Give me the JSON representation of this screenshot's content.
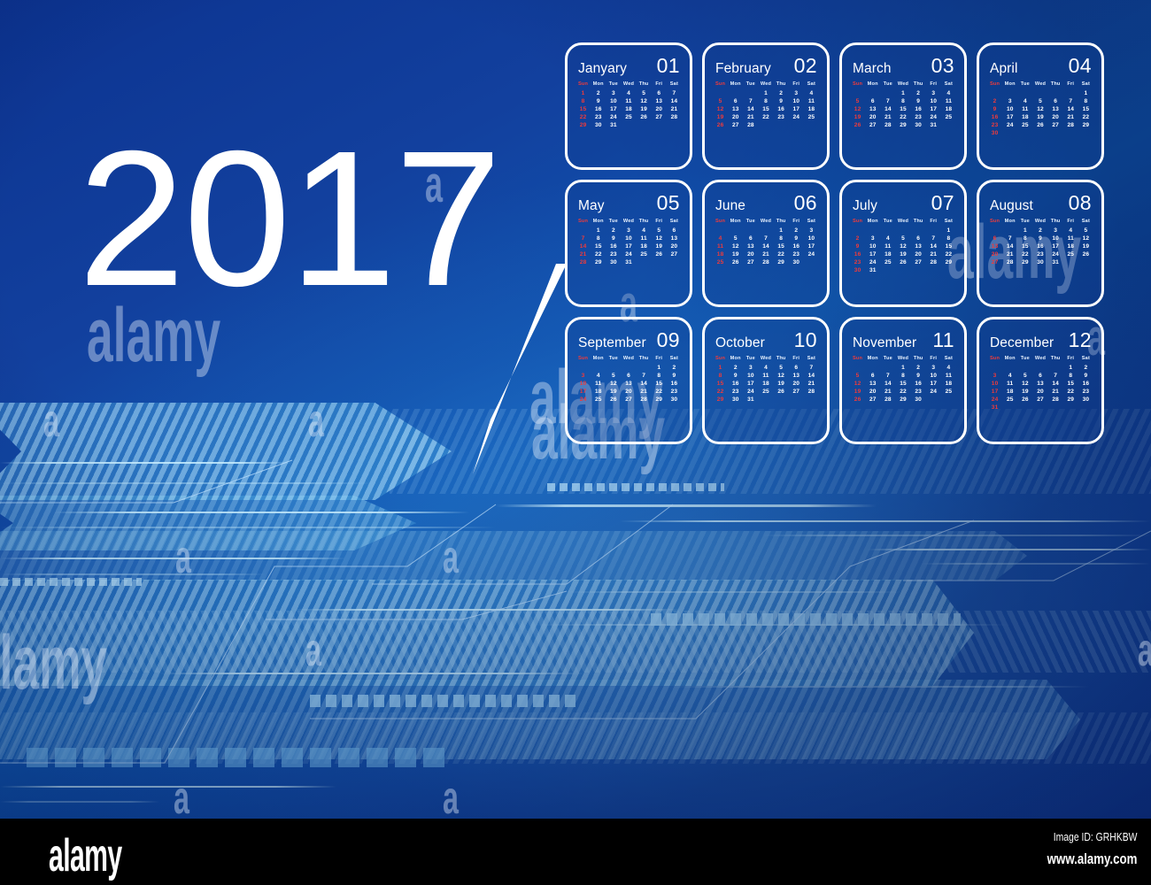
{
  "poster": {
    "year_label": "2017",
    "background_color": "#0c3390",
    "accent_color": "#4eaae2",
    "card_border_color": "#ffffff",
    "sunday_color": "#ef3b3b",
    "text_color": "#ffffff"
  },
  "weekdays": [
    "Sun",
    "Mon",
    "Tue",
    "Wed",
    "Thu",
    "Fri",
    "Sat"
  ],
  "months": [
    {
      "name": "Janyary",
      "number": "01",
      "weeks": [
        [
          "1",
          "2",
          "3",
          "4",
          "5",
          "6",
          "7"
        ],
        [
          "8",
          "9",
          "10",
          "11",
          "12",
          "13",
          "14"
        ],
        [
          "15",
          "16",
          "17",
          "18",
          "19",
          "20",
          "21"
        ],
        [
          "22",
          "23",
          "24",
          "25",
          "26",
          "27",
          "28"
        ],
        [
          "29",
          "30",
          "31",
          "",
          "",
          "",
          ""
        ],
        [
          "",
          "",
          "",
          "",
          "",
          "",
          ""
        ]
      ]
    },
    {
      "name": "February",
      "number": "02",
      "weeks": [
        [
          "",
          "",
          "",
          "1",
          "2",
          "3",
          "4"
        ],
        [
          "5",
          "6",
          "7",
          "8",
          "9",
          "10",
          "11"
        ],
        [
          "12",
          "13",
          "14",
          "15",
          "16",
          "17",
          "18"
        ],
        [
          "19",
          "20",
          "21",
          "22",
          "23",
          "24",
          "25"
        ],
        [
          "26",
          "27",
          "28",
          "",
          "",
          "",
          ""
        ],
        [
          "",
          "",
          "",
          "",
          "",
          "",
          ""
        ]
      ]
    },
    {
      "name": "March",
      "number": "03",
      "weeks": [
        [
          "",
          "",
          "",
          "1",
          "2",
          "3",
          "4"
        ],
        [
          "5",
          "6",
          "7",
          "8",
          "9",
          "10",
          "11"
        ],
        [
          "12",
          "13",
          "14",
          "15",
          "16",
          "17",
          "18"
        ],
        [
          "19",
          "20",
          "21",
          "22",
          "23",
          "24",
          "25"
        ],
        [
          "26",
          "27",
          "28",
          "29",
          "30",
          "31",
          ""
        ],
        [
          "",
          "",
          "",
          "",
          "",
          "",
          ""
        ]
      ]
    },
    {
      "name": "April",
      "number": "04",
      "weeks": [
        [
          "",
          "",
          "",
          "",
          "",
          "",
          "1"
        ],
        [
          "2",
          "3",
          "4",
          "5",
          "6",
          "7",
          "8"
        ],
        [
          "9",
          "10",
          "11",
          "12",
          "13",
          "14",
          "15"
        ],
        [
          "16",
          "17",
          "18",
          "19",
          "20",
          "21",
          "22"
        ],
        [
          "23",
          "24",
          "25",
          "26",
          "27",
          "28",
          "29"
        ],
        [
          "30",
          "",
          "",
          "",
          "",
          "",
          ""
        ]
      ]
    },
    {
      "name": "May",
      "number": "05",
      "weeks": [
        [
          "",
          "1",
          "2",
          "3",
          "4",
          "5",
          "6"
        ],
        [
          "7",
          "8",
          "9",
          "10",
          "11",
          "12",
          "13"
        ],
        [
          "14",
          "15",
          "16",
          "17",
          "18",
          "19",
          "20"
        ],
        [
          "21",
          "22",
          "23",
          "24",
          "25",
          "26",
          "27"
        ],
        [
          "28",
          "29",
          "30",
          "31",
          "",
          "",
          ""
        ],
        [
          "",
          "",
          "",
          "",
          "",
          "",
          ""
        ]
      ]
    },
    {
      "name": "June",
      "number": "06",
      "weeks": [
        [
          "",
          "",
          "",
          "",
          "1",
          "2",
          "3"
        ],
        [
          "4",
          "5",
          "6",
          "7",
          "8",
          "9",
          "10"
        ],
        [
          "11",
          "12",
          "13",
          "14",
          "15",
          "16",
          "17"
        ],
        [
          "18",
          "19",
          "20",
          "21",
          "22",
          "23",
          "24"
        ],
        [
          "25",
          "26",
          "27",
          "28",
          "29",
          "30",
          ""
        ],
        [
          "",
          "",
          "",
          "",
          "",
          "",
          ""
        ]
      ]
    },
    {
      "name": "July",
      "number": "07",
      "weeks": [
        [
          "",
          "",
          "",
          "",
          "",
          "",
          "1"
        ],
        [
          "2",
          "3",
          "4",
          "5",
          "6",
          "7",
          "8"
        ],
        [
          "9",
          "10",
          "11",
          "12",
          "13",
          "14",
          "15"
        ],
        [
          "16",
          "17",
          "18",
          "19",
          "20",
          "21",
          "22"
        ],
        [
          "23",
          "24",
          "25",
          "26",
          "27",
          "28",
          "29"
        ],
        [
          "30",
          "31",
          "",
          "",
          "",
          "",
          ""
        ]
      ]
    },
    {
      "name": "August",
      "number": "08",
      "weeks": [
        [
          "",
          "",
          "1",
          "2",
          "3",
          "4",
          "5"
        ],
        [
          "6",
          "7",
          "8",
          "9",
          "10",
          "11",
          "12"
        ],
        [
          "13",
          "14",
          "15",
          "16",
          "17",
          "18",
          "19"
        ],
        [
          "20",
          "21",
          "22",
          "23",
          "24",
          "25",
          "26"
        ],
        [
          "27",
          "28",
          "29",
          "30",
          "31",
          "",
          ""
        ],
        [
          "",
          "",
          "",
          "",
          "",
          "",
          ""
        ]
      ]
    },
    {
      "name": "September",
      "number": "09",
      "weeks": [
        [
          "",
          "",
          "",
          "",
          "",
          "1",
          "2"
        ],
        [
          "3",
          "4",
          "5",
          "6",
          "7",
          "8",
          "9"
        ],
        [
          "10",
          "11",
          "12",
          "13",
          "14",
          "15",
          "16"
        ],
        [
          "17",
          "18",
          "19",
          "20",
          "21",
          "22",
          "23"
        ],
        [
          "24",
          "25",
          "26",
          "27",
          "28",
          "29",
          "30"
        ],
        [
          "",
          "",
          "",
          "",
          "",
          "",
          ""
        ]
      ]
    },
    {
      "name": "October",
      "number": "10",
      "weeks": [
        [
          "1",
          "2",
          "3",
          "4",
          "5",
          "6",
          "7"
        ],
        [
          "8",
          "9",
          "10",
          "11",
          "12",
          "13",
          "14"
        ],
        [
          "15",
          "16",
          "17",
          "18",
          "19",
          "20",
          "21"
        ],
        [
          "22",
          "23",
          "24",
          "25",
          "26",
          "27",
          "28"
        ],
        [
          "29",
          "30",
          "31",
          "",
          "",
          "",
          ""
        ],
        [
          "",
          "",
          "",
          "",
          "",
          "",
          ""
        ]
      ]
    },
    {
      "name": "November",
      "number": "11",
      "weeks": [
        [
          "",
          "",
          "",
          "1",
          "2",
          "3",
          "4"
        ],
        [
          "5",
          "6",
          "7",
          "8",
          "9",
          "10",
          "11"
        ],
        [
          "12",
          "13",
          "14",
          "15",
          "16",
          "17",
          "18"
        ],
        [
          "19",
          "20",
          "21",
          "22",
          "23",
          "24",
          "25"
        ],
        [
          "26",
          "27",
          "28",
          "29",
          "30",
          "",
          ""
        ],
        [
          "",
          "",
          "",
          "",
          "",
          "",
          ""
        ]
      ]
    },
    {
      "name": "December",
      "number": "12",
      "weeks": [
        [
          "",
          "",
          "",
          "",
          "",
          "1",
          "2"
        ],
        [
          "3",
          "4",
          "5",
          "6",
          "7",
          "8",
          "9"
        ],
        [
          "10",
          "11",
          "12",
          "13",
          "14",
          "15",
          "16"
        ],
        [
          "17",
          "18",
          "19",
          "20",
          "21",
          "22",
          "23"
        ],
        [
          "24",
          "25",
          "26",
          "27",
          "28",
          "29",
          "30"
        ],
        [
          "31",
          "",
          "",
          "",
          "",
          "",
          ""
        ]
      ]
    }
  ],
  "watermarks": {
    "letter": "a",
    "word": "alamy"
  },
  "footer": {
    "logo": "alamy",
    "image_id": "Image ID: GRHKBW",
    "website": "www.alamy.com"
  }
}
